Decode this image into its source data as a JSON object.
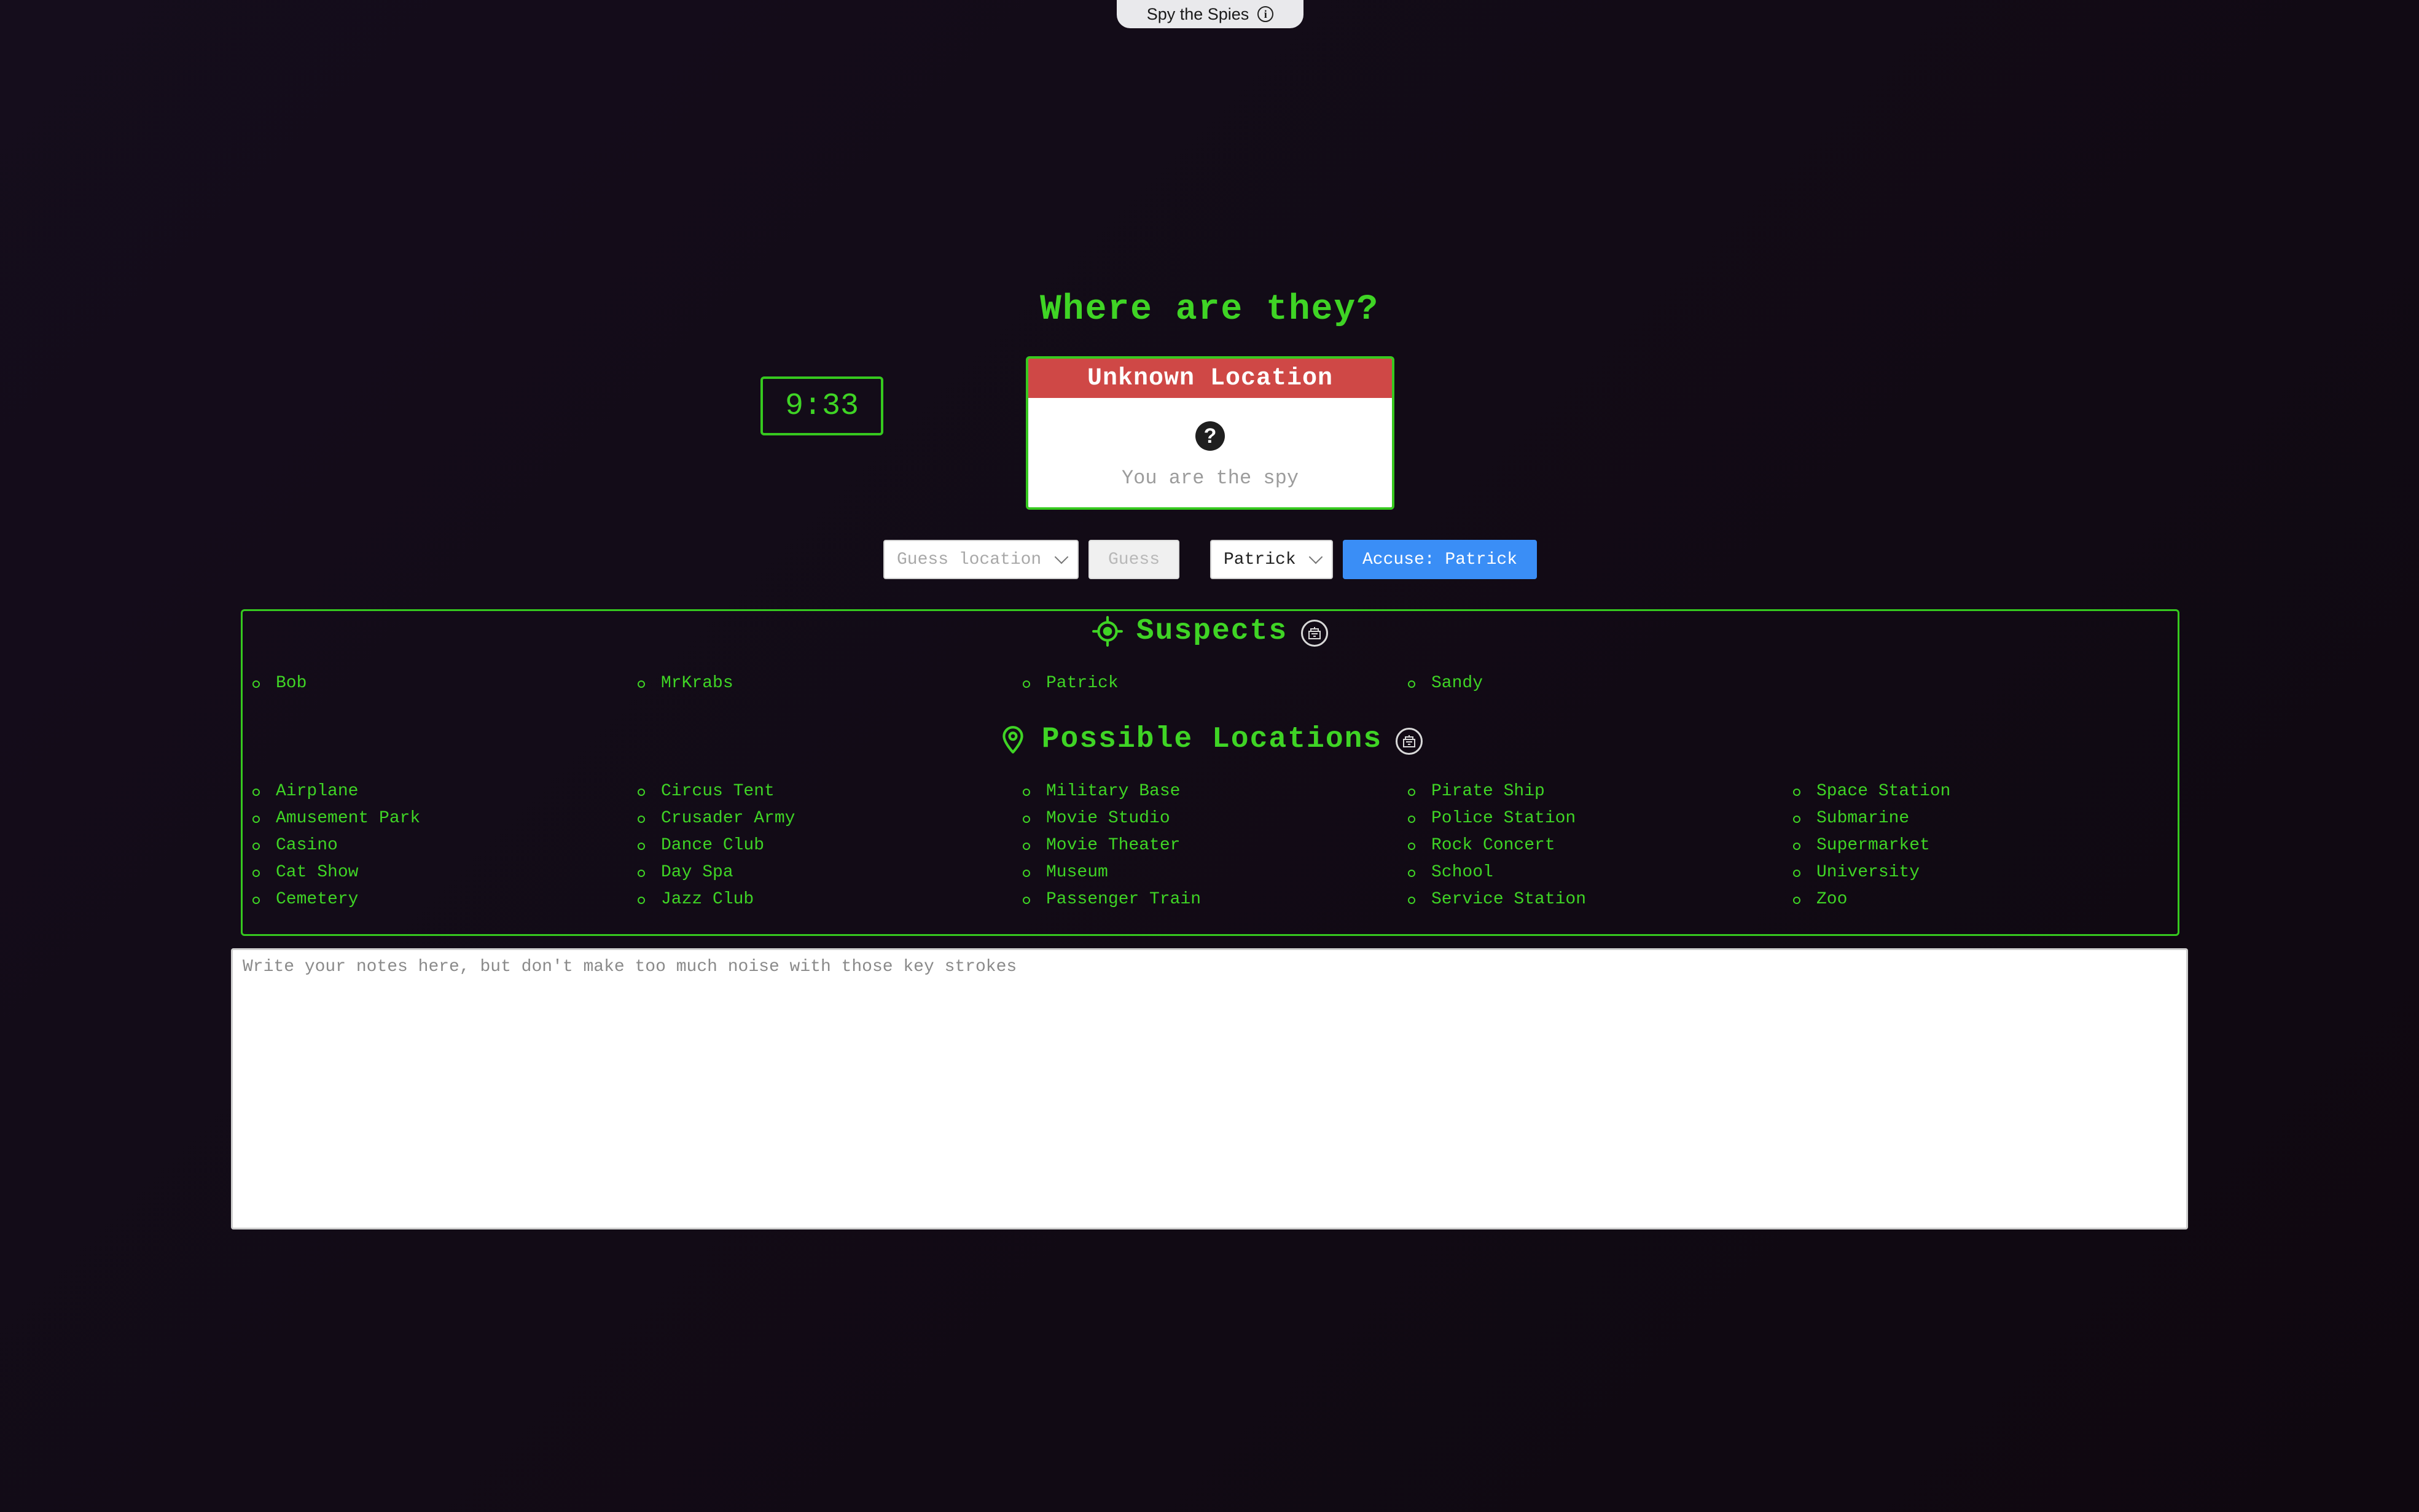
{
  "app": {
    "title": "Spy the Spies",
    "info_icon": "info-icon"
  },
  "game": {
    "heading": "Where are they?",
    "timer": "9:33",
    "location_card": {
      "title": "Unknown Location",
      "icon": "question-icon",
      "subtitle": "You are the spy"
    }
  },
  "controls": {
    "guess_select_value": "Guess location",
    "guess_button": "Guess",
    "suspect_select_value": "Patrick",
    "accuse_button": "Accuse: Patrick"
  },
  "suspects": {
    "title": "Suspects",
    "icon": "crosshair-icon",
    "items": [
      "Bob",
      "MrKrabs",
      "Patrick",
      "Sandy"
    ]
  },
  "locations": {
    "title": "Possible Locations",
    "icon": "map-pin-icon",
    "items": [
      "Airplane",
      "Amusement Park",
      "Casino",
      "Cat Show",
      "Cemetery",
      "Circus Tent",
      "Crusader Army",
      "Dance Club",
      "Day Spa",
      "Jazz Club",
      "Military Base",
      "Movie Studio",
      "Movie Theater",
      "Museum",
      "Passenger Train",
      "Pirate Ship",
      "Police Station",
      "Rock Concert",
      "School",
      "Service Station",
      "Space Station",
      "Submarine",
      "Supermarket",
      "University",
      "Zoo"
    ]
  },
  "notes": {
    "placeholder": "Write your notes here, but don't make too much noise with those key strokes",
    "value": ""
  },
  "colors": {
    "accent_green": "#3fd425",
    "card_header_red": "#cf4846",
    "accuse_blue": "#3a8ef6",
    "background": "#130c18"
  }
}
